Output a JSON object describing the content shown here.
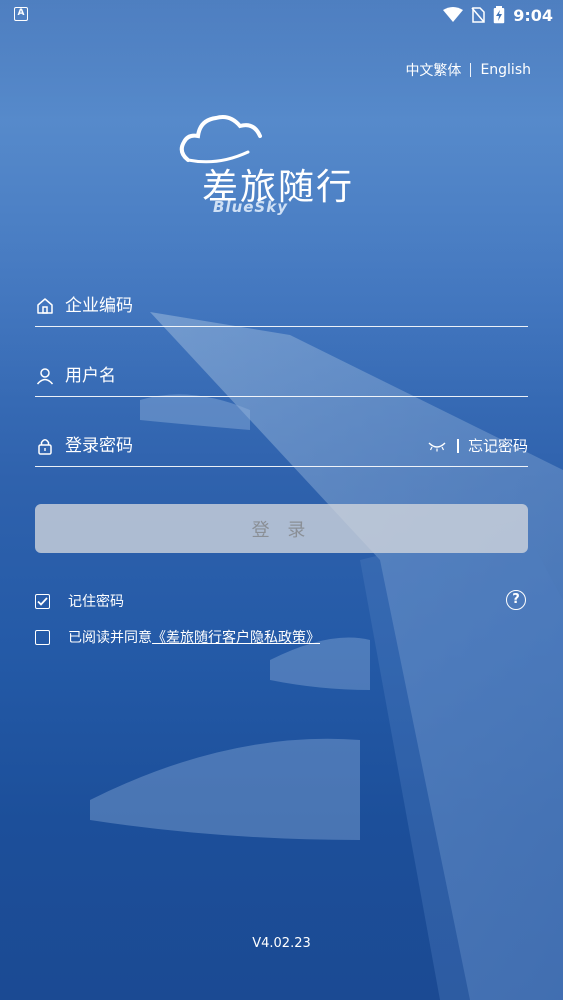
{
  "status_bar": {
    "left_icon": "A",
    "time": "9:04",
    "icons": [
      "wifi-icon",
      "no-sim-icon",
      "battery-charging-icon"
    ]
  },
  "language": {
    "options": [
      "中文繁体",
      "English"
    ]
  },
  "logo": {
    "title": "差旅随行",
    "subtitle": "BlueSky"
  },
  "form": {
    "company_placeholder": "企业编码",
    "username_placeholder": "用户名",
    "password_placeholder": "登录密码",
    "forgot_password": "忘记密码",
    "login_button": "登 录"
  },
  "options": {
    "remember_password": "记住密码",
    "remember_checked": true,
    "agree_prefix": "已阅读并同意",
    "agree_link": "《差旅随行客户隐私政策》",
    "agree_checked": false
  },
  "footer": {
    "version": "V4.02.23"
  },
  "colors": {
    "background": "#2f62ad",
    "button_bg": "#d2d6dc",
    "button_text": "#8a8f96"
  }
}
